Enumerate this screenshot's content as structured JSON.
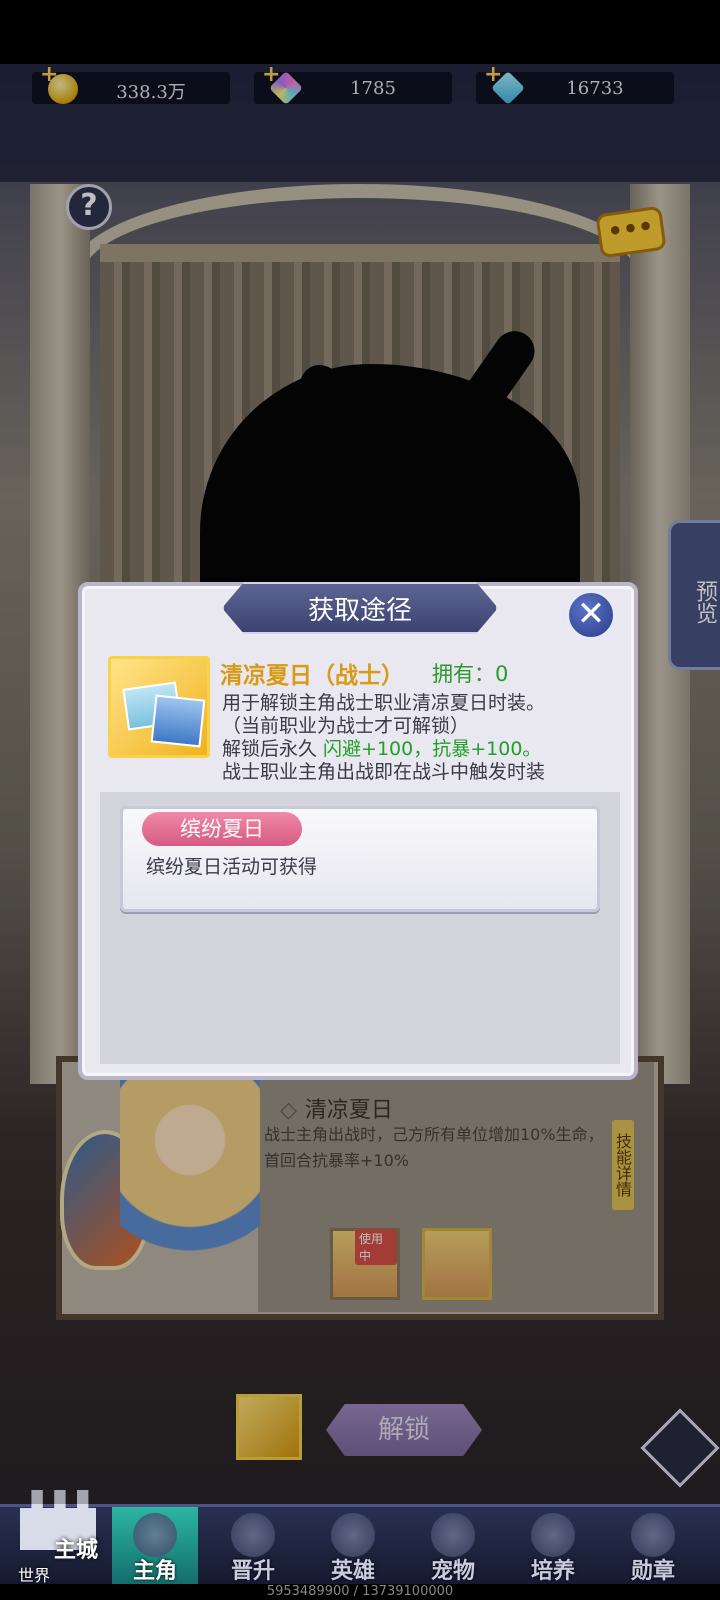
{
  "currencies": [
    {
      "icon": "gold-coin-icon",
      "value": "338.3万"
    },
    {
      "icon": "rainbow-gem-icon",
      "value": "1785"
    },
    {
      "icon": "blue-diamond-icon",
      "value": "16733"
    }
  ],
  "side": {
    "help": "?",
    "chat": "•••",
    "preview": "预览"
  },
  "popup": {
    "title": "获取途径",
    "close": "✕",
    "item_name": "清凉夏日（战士）",
    "owned": "拥有：0",
    "desc_line1": "用于解锁主角战士职业清凉夏日时装。",
    "desc_line2": "（当前职业为战士才可解锁）",
    "desc_line3_prefix": "解锁后永久 ",
    "desc_line3_bonus": "闪避+100，抗暴+100。",
    "desc_line4": "战士职业主角出战即在战斗中触发时装",
    "source_tag": "缤纷夏日",
    "source_text": "缤纷夏日活动可获得"
  },
  "skin_panel": {
    "name": "清凉夏日",
    "desc": "战士主角出战时，己方所有单位增加10%生命，首回合抗暴率+10%",
    "skill_btn": "技能详情",
    "in_use": "使用中"
  },
  "unlock": {
    "label": "解锁"
  },
  "bottom_nav": {
    "world_main": "主城",
    "world_sub": "世界",
    "items": [
      "主角",
      "晋升",
      "英雄",
      "宠物",
      "培养",
      "勋章"
    ],
    "active_index": 0
  },
  "footer_id": "5953489900 / 13739100000",
  "colors": {
    "accent_gold": "#d79a16",
    "bonus_green": "#21a02a",
    "tag_pink": "#d75a82",
    "nav_active": "#2bb6a2"
  }
}
